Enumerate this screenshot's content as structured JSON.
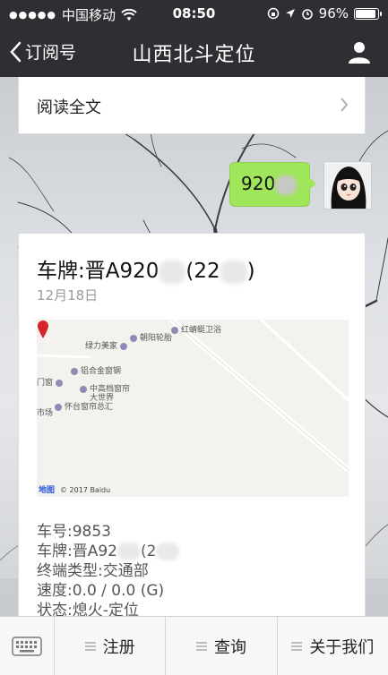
{
  "status_bar": {
    "carrier": "中国移动",
    "time": "08:50",
    "battery": "96%",
    "battery_level": 0.96
  },
  "nav": {
    "back_label": "订阅号",
    "title": "山西北斗定位"
  },
  "read_full": {
    "label": "阅读全文"
  },
  "outgoing_message": {
    "text": "920"
  },
  "card": {
    "title_prefix": "车牌:晋A920",
    "title_paren": "(22",
    "title_close": ")",
    "date": "12月18日",
    "map": {
      "labels": [
        "红蜻蜓卫浴",
        "朝阳轮胎",
        "绿力美家",
        "铝合金窗钢",
        "门窗",
        "中高档窗帘",
        "大世界",
        "怀台窗帘总汇",
        "市场"
      ],
      "copyright": "© 2017 Baidu",
      "logo": "地图"
    },
    "info": {
      "car_no": "车号:9853",
      "plate_prefix": "车牌:晋A92",
      "plate_paren": "(2",
      "terminal": "终端类型:交通部",
      "speed": "速度:0.0 / 0.0 (G)",
      "status": "状态:熄火-定位"
    }
  },
  "menu": {
    "items": [
      "注册",
      "查询",
      "关于我们"
    ]
  },
  "colors": {
    "nav_bg": "#2f2f33",
    "bubble_green": "#9fe65a",
    "pin_red": "#d9232b"
  }
}
